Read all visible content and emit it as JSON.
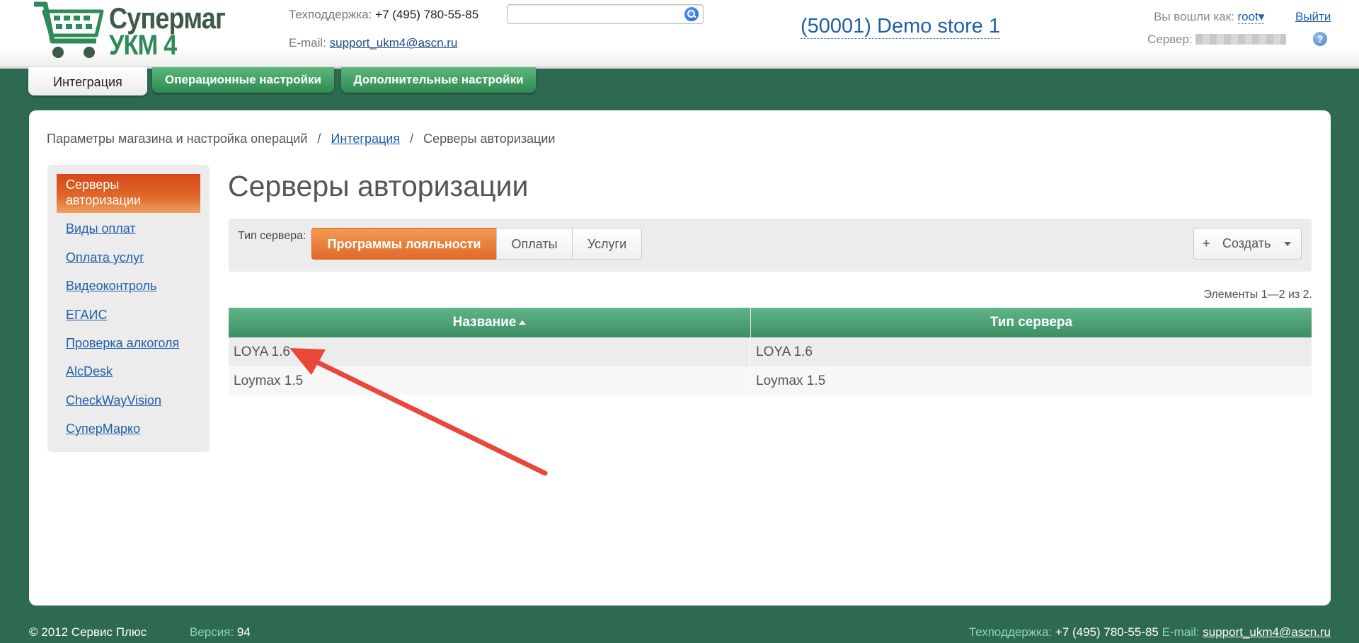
{
  "header": {
    "logo_line1": "Супермаг",
    "logo_line2": "УКМ 4",
    "support_label": "Техподдержка:",
    "support_phone": "+7 (495) 780-55-85",
    "email_label": "E-mail:",
    "email": "support_ukm4@ascn.ru",
    "search_placeholder": "",
    "store": "(50001) Demo store 1",
    "login_label": "Вы вошли как:",
    "login_user": "root",
    "logout": "Выйти",
    "server_label": "Сервер:",
    "help": "?"
  },
  "tabs": [
    {
      "label": "Интеграция",
      "active": true
    },
    {
      "label": "Операционные настройки",
      "active": false
    },
    {
      "label": "Дополнительные настройки",
      "active": false
    }
  ],
  "breadcrumb": {
    "root": "Параметры магазина и настройка операций",
    "sep": "/",
    "link": "Интеграция",
    "current": "Серверы авторизации"
  },
  "sidebar": {
    "active": "Серверы авторизации",
    "items": [
      "Виды оплат",
      "Оплата услуг",
      "Видеоконтроль",
      "ЕГАИС",
      "Проверка алкоголя",
      "AlcDesk",
      "CheckWayVision",
      "СуперМарко"
    ]
  },
  "main": {
    "title": "Серверы авторизации",
    "filter_label": "Тип сервера:",
    "filter_options": [
      "Программы лояльности",
      "Оплаты",
      "Услуги"
    ],
    "filter_selected": "Программы лояльности",
    "create_label": "Создать",
    "create_plus": "+",
    "count_text": "Элементы 1—2 из 2."
  },
  "table": {
    "columns": [
      "Название",
      "Тип сервера"
    ],
    "rows": [
      [
        "LOYA 1.6",
        "LOYA 1.6"
      ],
      [
        "Loymax 1.5",
        "Loymax 1.5"
      ]
    ]
  },
  "footer": {
    "copyright": "© 2012 Сервис Плюс",
    "version_label": "Версия:",
    "version": "94",
    "support_label": "Техподдержка:",
    "support_phone": "+7 (495) 780-55-85",
    "email_label": "E-mail:",
    "email": "support_ukm4@ascn.ru"
  },
  "colors": {
    "background": "#2e6a51",
    "accent_orange": "#e06a2a",
    "table_header": "#4ea676",
    "link": "#1f5fa8",
    "annotation_arrow": "#e8473a"
  }
}
